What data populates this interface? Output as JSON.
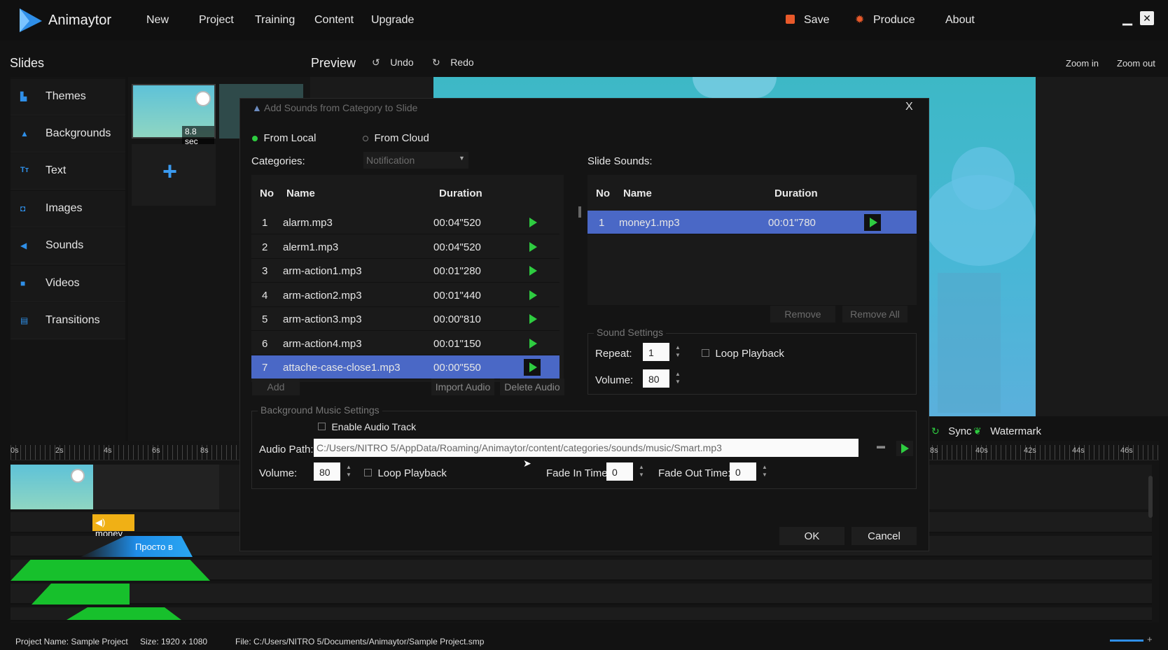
{
  "app": {
    "name": "Animaytor"
  },
  "menu": [
    "New",
    "Project",
    "Training",
    "Content",
    "Upgrade"
  ],
  "actions": {
    "save": "Save",
    "produce": "Produce",
    "about": "About"
  },
  "toolbar": {
    "slides": "Slides",
    "preview": "Preview",
    "undo": "Undo",
    "redo": "Redo",
    "zoom_in": "Zoom in",
    "zoom_out": "Zoom out"
  },
  "sidebar": {
    "items": [
      {
        "label": "Themes",
        "icon": "themes-icon"
      },
      {
        "label": "Backgrounds",
        "icon": "backgrounds-icon"
      },
      {
        "label": "Text",
        "icon": "text-icon"
      },
      {
        "label": "Images",
        "icon": "images-icon"
      },
      {
        "label": "Sounds",
        "icon": "sounds-icon"
      },
      {
        "label": "Videos",
        "icon": "videos-icon"
      },
      {
        "label": "Transitions",
        "icon": "transitions-icon"
      }
    ]
  },
  "slide_thumb": {
    "duration": "8.8 sec"
  },
  "dialog": {
    "title": "Add Sounds from Category to Slide",
    "close": "X",
    "source_local": "From Local",
    "source_cloud": "From Cloud",
    "categories_label": "Categories:",
    "category_value": "Notification",
    "slide_sounds_label": "Slide Sounds:",
    "cat_table": {
      "headers": [
        "No",
        "Name",
        "Duration"
      ],
      "rows": [
        [
          "1",
          "alarm.mp3",
          "00:04\"520"
        ],
        [
          "2",
          "alerm1.mp3",
          "00:04\"520"
        ],
        [
          "3",
          "arm-action1.mp3",
          "00:01\"280"
        ],
        [
          "4",
          "arm-action2.mp3",
          "00:01\"440"
        ],
        [
          "5",
          "arm-action3.mp3",
          "00:00\"810"
        ],
        [
          "6",
          "arm-action4.mp3",
          "00:01\"150"
        ],
        [
          "7",
          "attache-case-close1.mp3",
          "00:00\"550"
        ]
      ]
    },
    "slide_table": {
      "headers": [
        "No",
        "Name",
        "Duration"
      ],
      "rows": [
        [
          "1",
          "money1.mp3",
          "00:01\"780"
        ]
      ]
    },
    "add": "Add",
    "import_audio": "Import Audio",
    "delete_audio": "Delete Audio",
    "remove": "Remove",
    "remove_all": "Remove All",
    "sound_settings": {
      "title": "Sound Settings",
      "repeat_label": "Repeat:",
      "repeat": "1",
      "loop": "Loop Playback",
      "volume_label": "Volume:",
      "volume": "80"
    },
    "bg_music": {
      "title": "Background Music Settings",
      "enable": "Enable Audio Track",
      "audio_path_label": "Audio Path:",
      "audio_path": "C:/Users/NITRO 5/AppData/Roaming/Animaytor/content/categories/sounds/music/Smart.mp3",
      "volume_label": "Volume:",
      "volume": "80",
      "loop": "Loop Playback",
      "fade_in_label": "Fade In Time:",
      "fade_in": "0",
      "fade_out_label": "Fade Out Time:",
      "fade_out": "0"
    },
    "ok": "OK",
    "cancel": "Cancel"
  },
  "preview_bar": {
    "sync": "Sync",
    "watermark": "Watermark"
  },
  "timeline": {
    "ticks_left": [
      "0s",
      "2s",
      "4s",
      "6s",
      "8s"
    ],
    "ticks_right": [
      "8s",
      "40s",
      "42s",
      "44s",
      "46s"
    ],
    "sound_clip": "money",
    "text_clip": "Просто в"
  },
  "status": {
    "project": "Project Name: Sample Project",
    "size": "Size: 1920 x 1080",
    "file": "File: C:/Users/NITRO 5/Documents/Animaytor/Sample Project.smp"
  },
  "colors": {
    "accent": "#4a68c6",
    "play": "#2ecc40",
    "brand": "#2f8fe8",
    "orange": "#e8592a"
  }
}
